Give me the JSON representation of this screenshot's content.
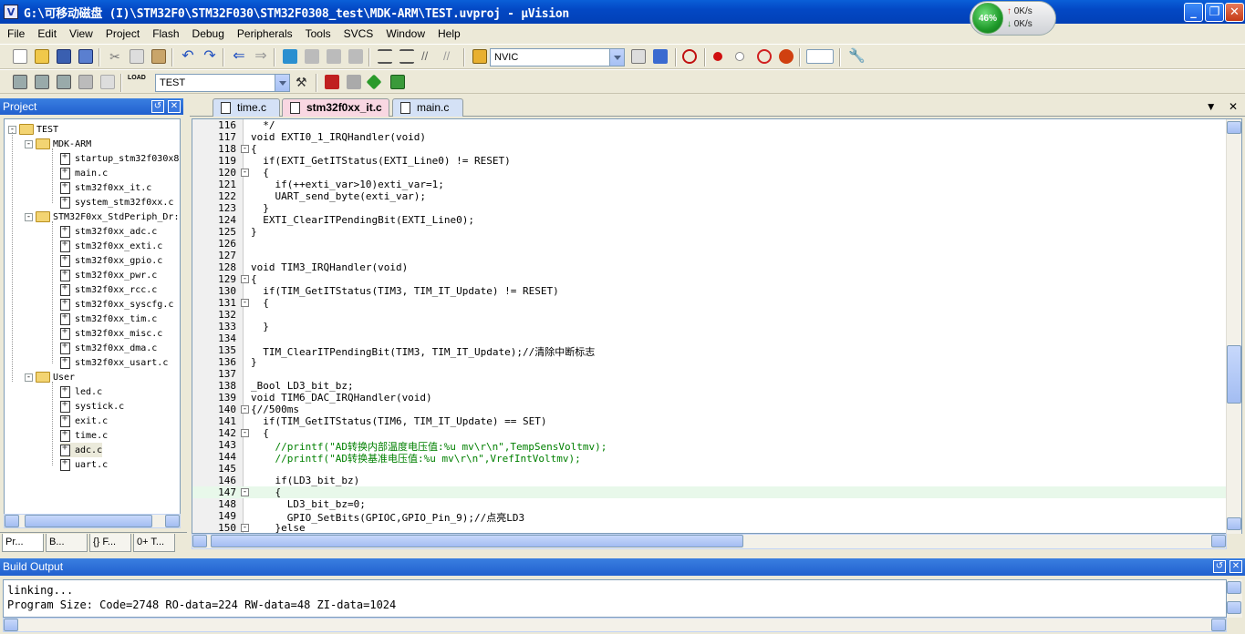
{
  "window": {
    "title": "G:\\可移动磁盘 (I)\\STM32F0\\STM32F030\\STM32F0308_test\\MDK-ARM\\TEST.uvproj - µVision",
    "app_icon_letter": "V"
  },
  "netmon": {
    "percent": "46%",
    "up": "0K/s",
    "down": "0K/s"
  },
  "menu": [
    "File",
    "Edit",
    "View",
    "Project",
    "Flash",
    "Debug",
    "Peripherals",
    "Tools",
    "SVCS",
    "Window",
    "Help"
  ],
  "toolbar": {
    "nvic_select": "NVIC",
    "target_select": "TEST"
  },
  "project_panel": {
    "title": "Project",
    "root": "TEST",
    "groups": [
      {
        "name": "MDK-ARM",
        "files": [
          "startup_stm32f030x8",
          "main.c",
          "stm32f0xx_it.c",
          "system_stm32f0xx.c"
        ]
      },
      {
        "name": "STM32F0xx_StdPeriph_Dr:",
        "files": [
          "stm32f0xx_adc.c",
          "stm32f0xx_exti.c",
          "stm32f0xx_gpio.c",
          "stm32f0xx_pwr.c",
          "stm32f0xx_rcc.c",
          "stm32f0xx_syscfg.c",
          "stm32f0xx_tim.c",
          "stm32f0xx_misc.c",
          "stm32f0xx_dma.c",
          "stm32f0xx_usart.c"
        ]
      },
      {
        "name": "User",
        "files": [
          "led.c",
          "systick.c",
          "exit.c",
          "time.c",
          "adc.c",
          "uart.c"
        ]
      }
    ],
    "tabs": [
      "Pr...",
      "B...",
      "{} F...",
      "0+ T..."
    ]
  },
  "editor": {
    "tabs": [
      {
        "label": "time.c"
      },
      {
        "label": "stm32f0xx_it.c"
      },
      {
        "label": "main.c"
      }
    ],
    "lines": [
      {
        "n": "116",
        "t": "  */"
      },
      {
        "n": "117",
        "t": "void EXTI0_1_IRQHandler(void)"
      },
      {
        "n": "118",
        "t": "{",
        "f": "-"
      },
      {
        "n": "119",
        "t": "  if(EXTI_GetITStatus(EXTI_Line0) != RESET)"
      },
      {
        "n": "120",
        "t": "  {",
        "f": "-"
      },
      {
        "n": "121",
        "t": "    if(++exti_var>10)exti_var=1;"
      },
      {
        "n": "122",
        "t": "    UART_send_byte(exti_var);"
      },
      {
        "n": "123",
        "t": "  }"
      },
      {
        "n": "124",
        "t": "  EXTI_ClearITPendingBit(EXTI_Line0);"
      },
      {
        "n": "125",
        "t": "}"
      },
      {
        "n": "126",
        "t": ""
      },
      {
        "n": "127",
        "t": ""
      },
      {
        "n": "128",
        "t": "void TIM3_IRQHandler(void)"
      },
      {
        "n": "129",
        "t": "{",
        "f": "-"
      },
      {
        "n": "130",
        "t": "  if(TIM_GetITStatus(TIM3, TIM_IT_Update) != RESET)"
      },
      {
        "n": "131",
        "t": "  {",
        "f": "-"
      },
      {
        "n": "132",
        "t": ""
      },
      {
        "n": "133",
        "t": "  }"
      },
      {
        "n": "134",
        "t": ""
      },
      {
        "n": "135",
        "t": "  TIM_ClearITPendingBit(TIM3, TIM_IT_Update);//清除中断标志"
      },
      {
        "n": "136",
        "t": "}"
      },
      {
        "n": "137",
        "t": ""
      },
      {
        "n": "138",
        "t": "_Bool LD3_bit_bz;"
      },
      {
        "n": "139",
        "t": "void TIM6_DAC_IRQHandler(void)"
      },
      {
        "n": "140",
        "t": "{//500ms",
        "f": "-"
      },
      {
        "n": "141",
        "t": "  if(TIM_GetITStatus(TIM6, TIM_IT_Update) == SET)"
      },
      {
        "n": "142",
        "t": "  {",
        "f": "-"
      },
      {
        "n": "143",
        "t": "    //printf(\"AD转换内部温度电压值:%u mv\\r\\n\",TempSensVoltmv);"
      },
      {
        "n": "144",
        "t": "    //printf(\"AD转换基准电压值:%u mv\\r\\n\",VrefIntVoltmv);"
      },
      {
        "n": "145",
        "t": ""
      },
      {
        "n": "146",
        "t": "    if(LD3_bit_bz)"
      },
      {
        "n": "147",
        "t": "    {",
        "f": "-",
        "hl": true
      },
      {
        "n": "148",
        "t": "      LD3_bit_bz=0;"
      },
      {
        "n": "149",
        "t": "      GPIO_SetBits(GPIOC,GPIO_Pin_9);//点亮LD3"
      },
      {
        "n": "150",
        "t": "    }else",
        "f": "-"
      }
    ]
  },
  "build_output": {
    "title": "Build Output",
    "lines": [
      "linking...",
      "Program Size: Code=2748 RO-data=224 RW-data=48 ZI-data=1024"
    ]
  }
}
